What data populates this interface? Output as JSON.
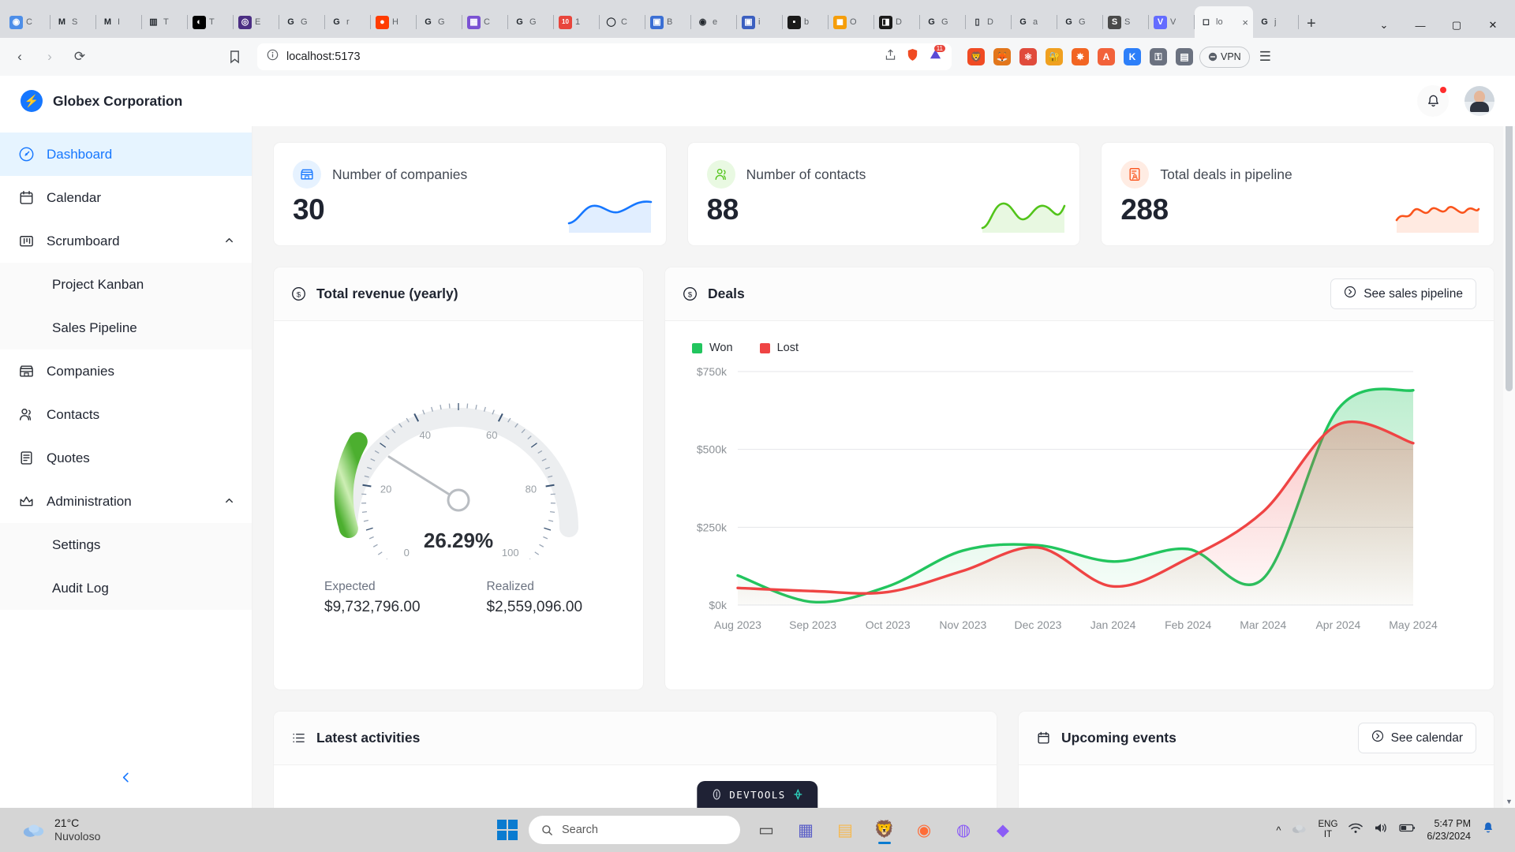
{
  "browser": {
    "tabs": [
      {
        "title": "C",
        "favicon": "chrome-icon",
        "color": "#4d8ee8",
        "glyph": "◉"
      },
      {
        "title": "S",
        "favicon": "gmail-icon",
        "color": "#ffffff",
        "glyph": "M"
      },
      {
        "title": "I",
        "favicon": "gmail-icon",
        "color": "#ffffff",
        "glyph": "M"
      },
      {
        "title": "T",
        "favicon": "chart-icon",
        "color": "#ffffff",
        "glyph": "▥"
      },
      {
        "title": "T",
        "favicon": "medium-icon",
        "color": "#000000",
        "glyph": "◐"
      },
      {
        "title": "E",
        "favicon": "vault-icon",
        "color": "#4b2e83",
        "glyph": "◎"
      },
      {
        "title": "G",
        "favicon": "github-icon",
        "color": "#ffffff",
        "glyph": "G"
      },
      {
        "title": "r",
        "favicon": "github-icon",
        "color": "#ffffff",
        "glyph": "G"
      },
      {
        "title": "H",
        "favicon": "hotjar-icon",
        "color": "#ff3c00",
        "glyph": "●"
      },
      {
        "title": "G",
        "favicon": "github-icon",
        "color": "#ffffff",
        "glyph": "G"
      },
      {
        "title": "C",
        "favicon": "app-icon",
        "color": "#7b52d3",
        "glyph": "▦"
      },
      {
        "title": "G",
        "favicon": "github-icon",
        "color": "#ffffff",
        "glyph": "G"
      },
      {
        "title": "1",
        "favicon": "number-ten-icon",
        "color": "#e8453c",
        "glyph": "10"
      },
      {
        "title": "C",
        "favicon": "generic-icon",
        "color": "#ffffff",
        "glyph": "◯"
      },
      {
        "title": "B",
        "favicon": "blue-icon",
        "color": "#3b6fd4",
        "glyph": "▣"
      },
      {
        "title": "e",
        "favicon": "eye-icon",
        "color": "#ffffff",
        "glyph": "◉"
      },
      {
        "title": "i",
        "favicon": "instagram-icon",
        "color": "#3b5fc0",
        "glyph": "▣"
      },
      {
        "title": "b",
        "favicon": "bmg-icon",
        "color": "#1a1a1a",
        "glyph": "▪"
      },
      {
        "title": "O",
        "favicon": "orange-icon",
        "color": "#f59e0b",
        "glyph": "◼"
      },
      {
        "title": "D",
        "favicon": "dark-icon",
        "color": "#1a1a1a",
        "glyph": "◨"
      },
      {
        "title": "G",
        "favicon": "github-icon",
        "color": "#ffffff",
        "glyph": "G"
      },
      {
        "title": "D",
        "favicon": "doc-icon",
        "color": "#ffffff",
        "glyph": "▯"
      },
      {
        "title": "a",
        "favicon": "github-icon",
        "color": "#ffffff",
        "glyph": "G"
      },
      {
        "title": "G",
        "favicon": "github-icon",
        "color": "#ffffff",
        "glyph": "G"
      },
      {
        "title": "S",
        "favicon": "search-icon",
        "color": "#4a4a4a",
        "glyph": "S"
      },
      {
        "title": "V",
        "favicon": "vite-icon",
        "color": "#646cff",
        "glyph": "V"
      },
      {
        "title": "lo",
        "favicon": "localhost-icon",
        "color": "#cfd4da",
        "glyph": "◻",
        "active": true
      },
      {
        "title": "j",
        "favicon": "github-icon",
        "color": "#ffffff",
        "glyph": "G"
      }
    ],
    "new_tab_label": "+",
    "window_controls": {
      "minimize": "—",
      "maximize": "▢",
      "close": "✕",
      "tab_list": "⌄"
    },
    "nav": {
      "back": "‹",
      "forward": "›",
      "reload": "⟳",
      "bookmark": "🔖"
    },
    "address": {
      "url": "localhost:5173",
      "info_icon": "info-icon",
      "share_icon": "share-icon"
    },
    "extensions": [
      {
        "name": "brave-shield-icon",
        "color": "#f04b23",
        "glyph": "🦁"
      },
      {
        "name": "metamask-icon",
        "color": "#e2761b",
        "glyph": "🦊"
      },
      {
        "name": "react-devtools-icon",
        "color": "#e04b3c",
        "glyph": "⚛"
      },
      {
        "name": "bitwarden-icon",
        "color": "#f0a020",
        "glyph": "🔐"
      },
      {
        "name": "star-icon",
        "color": "#f26522",
        "glyph": "✸"
      },
      {
        "name": "angular-icon",
        "color": "#f2623a",
        "glyph": "A"
      },
      {
        "name": "kagi-icon",
        "color": "#2d7ff9",
        "glyph": "K"
      },
      {
        "name": "puzzle-icon",
        "color": "#6b7280",
        "glyph": "⚿"
      },
      {
        "name": "wallet-icon",
        "color": "#6b7280",
        "glyph": "▤"
      }
    ],
    "vpn_label": "VPN",
    "menu_icon": "hamburger-icon"
  },
  "app": {
    "brand": {
      "name": "Globex Corporation",
      "logo": "lightning-bolt-icon"
    },
    "header": {
      "notification_icon": "bell-icon",
      "has_notification": true,
      "avatar": "user-avatar"
    },
    "sidebar": {
      "items": [
        {
          "label": "Dashboard",
          "icon": "gauge-icon",
          "active": true
        },
        {
          "label": "Calendar",
          "icon": "calendar-icon",
          "active": false
        },
        {
          "label": "Scrumboard",
          "icon": "kanban-icon",
          "active": false,
          "expandable": true,
          "expanded": true,
          "children": [
            {
              "label": "Project Kanban"
            },
            {
              "label": "Sales Pipeline"
            }
          ]
        },
        {
          "label": "Companies",
          "icon": "building-icon",
          "active": false
        },
        {
          "label": "Contacts",
          "icon": "people-icon",
          "active": false
        },
        {
          "label": "Quotes",
          "icon": "document-icon",
          "active": false
        },
        {
          "label": "Administration",
          "icon": "crown-icon",
          "active": false,
          "expandable": true,
          "expanded": true,
          "children": [
            {
              "label": "Settings"
            },
            {
              "label": "Audit Log"
            }
          ]
        }
      ],
      "collapse_icon": "chevron-left-icon",
      "caret_icon": "chevron-up-icon"
    },
    "kpis": [
      {
        "title": "Number of companies",
        "value": "30",
        "icon": "store-icon",
        "icon_color": "#1677ff",
        "icon_bg": "#e6f2ff",
        "line_color": "#1677ff",
        "fill_color": "#c9e0ff"
      },
      {
        "title": "Number of contacts",
        "value": "88",
        "icon": "contacts-icon",
        "icon_color": "#52c41a",
        "icon_bg": "#e9f9e2",
        "line_color": "#52c41a",
        "fill_color": "#d6f3c8"
      },
      {
        "title": "Total deals in pipeline",
        "value": "288",
        "icon": "deal-icon",
        "icon_color": "#fa541c",
        "icon_bg": "#ffece3",
        "line_color": "#fa541c",
        "fill_color": "#ffd8c8"
      }
    ],
    "revenue": {
      "title": "Total revenue (yearly)",
      "icon": "dollar-circle-icon",
      "percent_label": "26.29%",
      "percent_value": 26.29,
      "gauge_ticks": [
        "0",
        "20",
        "40",
        "60",
        "80",
        "100"
      ],
      "expected_label": "Expected",
      "expected_value": "$9,732,796.00",
      "realized_label": "Realized",
      "realized_value": "$2,559,096.00"
    },
    "deals": {
      "title": "Deals",
      "icon": "dollar-circle-icon",
      "action_label": "See sales pipeline",
      "action_icon": "arrow-right-circle-icon"
    },
    "latest_activities": {
      "title": "Latest activities",
      "icon": "list-icon"
    },
    "upcoming_events": {
      "title": "Upcoming events",
      "icon": "calendar-icon",
      "action_label": "See calendar",
      "action_icon": "arrow-right-circle-icon"
    },
    "devtools_badge": {
      "label": "DEVTOOLS",
      "icon": "devtools-icon",
      "accent": "#2dd4bf"
    }
  },
  "chart_data": {
    "type": "area",
    "title": "Deals",
    "xlabel": "",
    "ylabel": "",
    "grid": true,
    "legend_position": "top-left",
    "ylim": [
      0,
      750000
    ],
    "ytick_labels": [
      "$0k",
      "$250k",
      "$500k",
      "$750k"
    ],
    "ytick_values": [
      0,
      250000,
      500000,
      750000
    ],
    "categories": [
      "Aug 2023",
      "Sep 2023",
      "Oct 2023",
      "Nov 2023",
      "Dec 2023",
      "Jan 2024",
      "Feb 2024",
      "Mar 2024",
      "Apr 2024",
      "May 2024"
    ],
    "series": [
      {
        "name": "Won",
        "color": "#22c55e",
        "values": [
          95000,
          10000,
          60000,
          175000,
          192000,
          140000,
          180000,
          85000,
          630000,
          690000
        ]
      },
      {
        "name": "Lost",
        "color": "#ef4444",
        "values": [
          55000,
          45000,
          42000,
          110000,
          185000,
          60000,
          150000,
          300000,
          580000,
          520000
        ]
      }
    ]
  },
  "taskbar": {
    "weather": {
      "temp": "21°C",
      "condition": "Nuvoloso",
      "icon": "cloud-icon"
    },
    "start_icon": "windows-logo",
    "search_placeholder": "Search",
    "search_icon": "search-icon",
    "apps": [
      {
        "name": "task-view-icon",
        "glyph": "▭",
        "color": "#4a4a4a"
      },
      {
        "name": "teams-icon",
        "glyph": "▦",
        "color": "#5b5fc7"
      },
      {
        "name": "file-explorer-icon",
        "glyph": "▤",
        "color": "#f7b84b"
      },
      {
        "name": "brave-browser-icon",
        "glyph": "🦁",
        "color": "#f04b23",
        "active": true
      },
      {
        "name": "postman-icon",
        "glyph": "◉",
        "color": "#ff6c37"
      },
      {
        "name": "krita-icon",
        "glyph": "◍",
        "color": "#8b5cf6"
      },
      {
        "name": "visual-studio-icon",
        "glyph": "◆",
        "color": "#8b5cf6"
      }
    ],
    "tray": {
      "chevron": "^",
      "cloud_icon": "onedrive-icon",
      "language_primary": "ENG",
      "language_secondary": "IT",
      "wifi_icon": "wifi-icon",
      "volume_icon": "speaker-icon",
      "battery_icon": "battery-icon",
      "time": "5:47 PM",
      "date": "6/23/2024",
      "notification_icon": "bell-icon"
    }
  }
}
